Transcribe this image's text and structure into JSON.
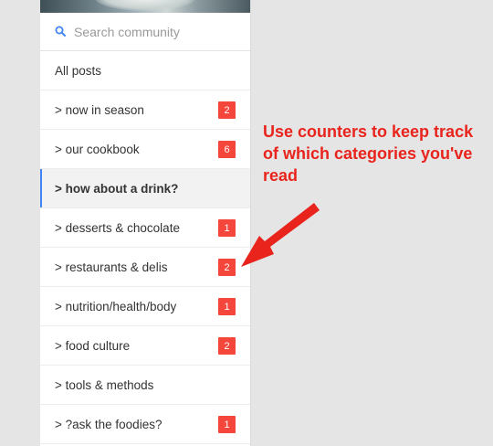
{
  "search": {
    "placeholder": "Search community"
  },
  "nav": {
    "items": [
      {
        "label": "All posts",
        "badge": ""
      },
      {
        "label": "> now in season",
        "badge": "2"
      },
      {
        "label": "> our cookbook",
        "badge": "6"
      },
      {
        "label": "> how about a drink?",
        "badge": "",
        "active": true
      },
      {
        "label": "> desserts & chocolate",
        "badge": "1"
      },
      {
        "label": "> restaurants & delis",
        "badge": "2"
      },
      {
        "label": "> nutrition/health/body",
        "badge": "1"
      },
      {
        "label": "> food culture",
        "badge": "2"
      },
      {
        "label": "> tools & methods",
        "badge": ""
      },
      {
        "label": "> ?ask the foodies?",
        "badge": "1"
      }
    ]
  },
  "annotation": {
    "text": "Use counters to keep track of which categories you've read",
    "color": "#e8241c"
  },
  "colors": {
    "badge": "#f4463b",
    "active_indicator": "#4285f4",
    "search_icon": "#4285f4"
  },
  "icons": {
    "search": "search-icon",
    "annotation_arrow": "arrow-icon"
  }
}
